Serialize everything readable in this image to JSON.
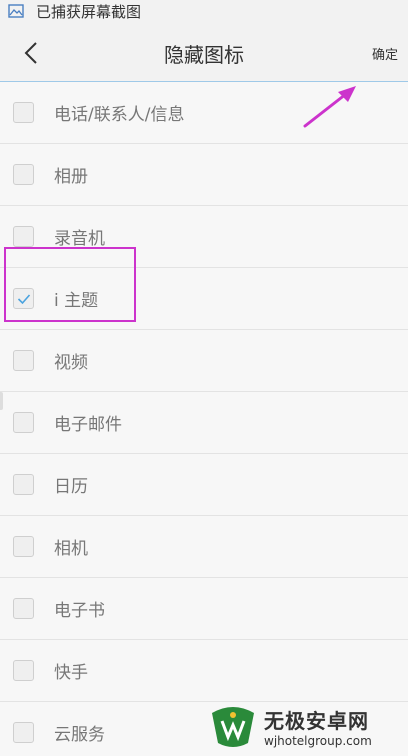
{
  "status_bar": {
    "text": "已捕获屏幕截图",
    "icon": "image-icon"
  },
  "header": {
    "title": "隐藏图标",
    "confirm_label": "确定",
    "back_icon": "back-chevron-icon"
  },
  "items": [
    {
      "label": "电话/联系人/信息",
      "checked": false
    },
    {
      "label": "相册",
      "checked": false
    },
    {
      "label": "录音机",
      "checked": false
    },
    {
      "label": "i 主题",
      "checked": true
    },
    {
      "label": "视频",
      "checked": false
    },
    {
      "label": "电子邮件",
      "checked": false
    },
    {
      "label": "日历",
      "checked": false
    },
    {
      "label": "相机",
      "checked": false
    },
    {
      "label": "电子书",
      "checked": false
    },
    {
      "label": "快手",
      "checked": false
    },
    {
      "label": "云服务",
      "checked": false
    }
  ],
  "watermark": {
    "title": "无极安卓网",
    "url": "wjhotelgroup.com"
  },
  "colors": {
    "annotation": "#cc33cc",
    "check": "#4aa3df"
  }
}
